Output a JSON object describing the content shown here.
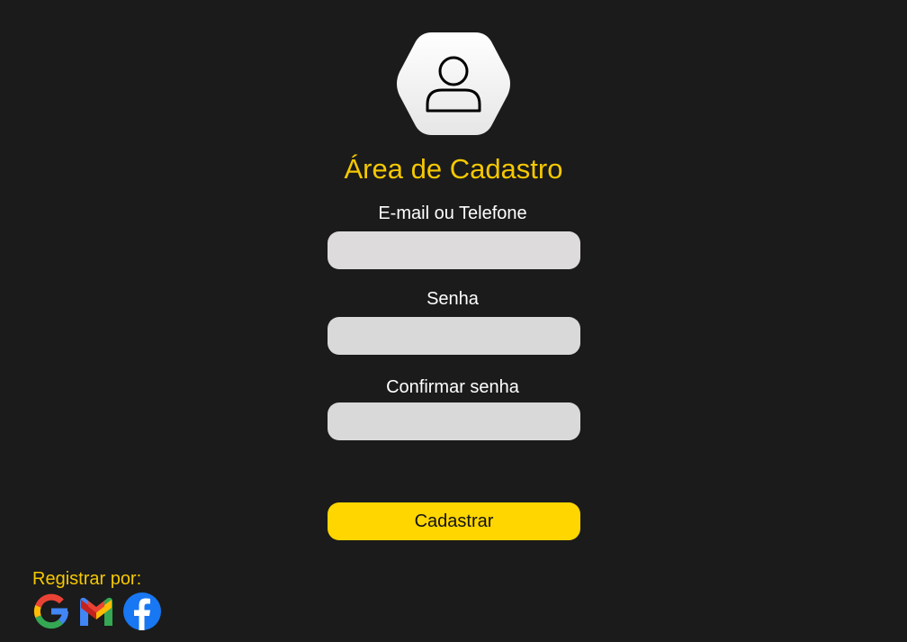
{
  "header": {
    "title": "Área de Cadastro",
    "avatar_icon": "user-icon"
  },
  "form": {
    "fields": [
      {
        "label": "E-mail ou Telefone",
        "value": "",
        "placeholder": ""
      },
      {
        "label": "Senha",
        "value": "",
        "placeholder": ""
      },
      {
        "label": "Confirmar senha",
        "value": "",
        "placeholder": ""
      }
    ],
    "submit_label": "Cadastrar"
  },
  "social": {
    "label": "Registrar por:",
    "providers": [
      {
        "icon": "google-icon"
      },
      {
        "icon": "gmail-icon"
      },
      {
        "icon": "facebook-icon"
      }
    ]
  },
  "colors": {
    "background": "#1b1b1b",
    "accent": "#f5c800",
    "button": "#ffd600",
    "input": "#d9d9d9"
  }
}
